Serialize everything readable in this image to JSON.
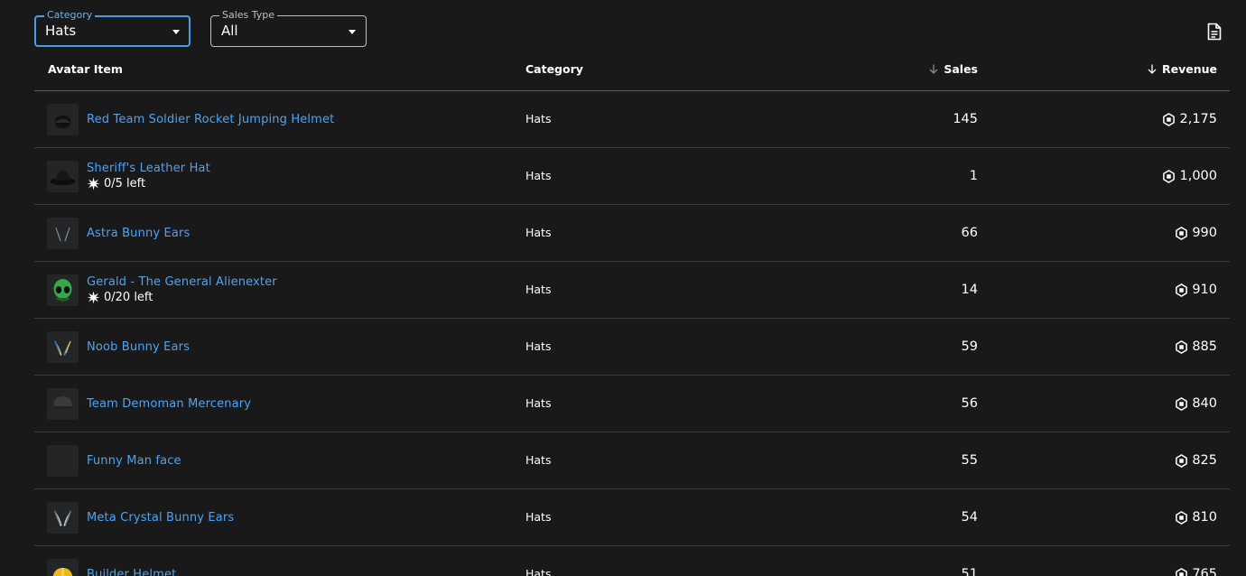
{
  "filters": {
    "category": {
      "label": "Category",
      "value": "Hats"
    },
    "sales_type": {
      "label": "Sales Type",
      "value": "All"
    }
  },
  "table": {
    "headers": {
      "item": "Avatar Item",
      "category": "Category",
      "sales": "Sales",
      "revenue": "Revenue"
    },
    "rows": [
      {
        "name": "Red Team Soldier Rocket Jumping Helmet",
        "limited": "",
        "category": "Hats",
        "sales": "145",
        "revenue": "2,175",
        "thumb": "dark-helmet"
      },
      {
        "name": "Sheriff's Leather Hat",
        "limited": "0/5 left",
        "category": "Hats",
        "sales": "1",
        "revenue": "1,000",
        "thumb": "black-hat"
      },
      {
        "name": "Astra Bunny Ears",
        "limited": "",
        "category": "Hats",
        "sales": "66",
        "revenue": "990",
        "thumb": "dark-ears"
      },
      {
        "name": "Gerald - The General Alienexter",
        "limited": "0/20 left",
        "category": "Hats",
        "sales": "14",
        "revenue": "910",
        "thumb": "green-alien"
      },
      {
        "name": "Noob Bunny Ears",
        "limited": "",
        "category": "Hats",
        "sales": "59",
        "revenue": "885",
        "thumb": "blue-yellow-ears"
      },
      {
        "name": "Team Demoman Mercenary",
        "limited": "",
        "category": "Hats",
        "sales": "56",
        "revenue": "840",
        "thumb": "dark-dome"
      },
      {
        "name": "Funny Man face",
        "limited": "",
        "category": "Hats",
        "sales": "55",
        "revenue": "825",
        "thumb": "empty"
      },
      {
        "name": "Meta Crystal Bunny Ears",
        "limited": "",
        "category": "Hats",
        "sales": "54",
        "revenue": "810",
        "thumb": "silver-ears"
      },
      {
        "name": "Builder Helmet",
        "limited": "",
        "category": "Hats",
        "sales": "51",
        "revenue": "765",
        "thumb": "yellow-helmet"
      }
    ]
  }
}
